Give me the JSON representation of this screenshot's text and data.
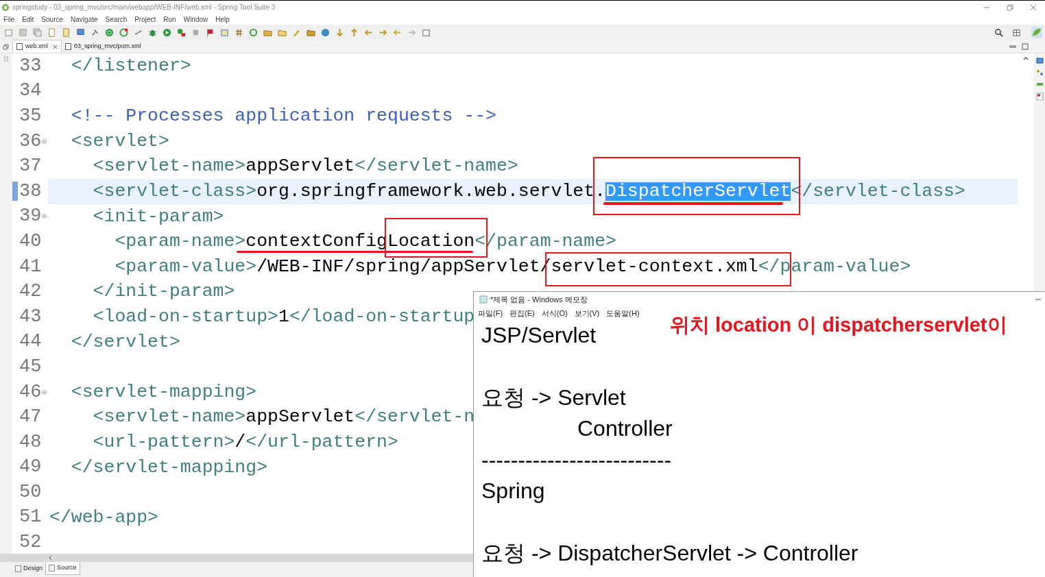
{
  "window": {
    "title": "springstudy - 03_spring_mvc/src/main/webapp/WEB-INF/web.xml - Spring Tool Suite 3"
  },
  "menu": [
    "File",
    "Edit",
    "Source",
    "Navigate",
    "Search",
    "Project",
    "Run",
    "Window",
    "Help"
  ],
  "editor_tabs": [
    {
      "label": "web.xml",
      "selected": true,
      "closable": true
    },
    {
      "label": "03_spring_mvc/pom.xml",
      "selected": false,
      "closable": false
    }
  ],
  "code_lines": [
    {
      "number": "33",
      "foldable": false,
      "current": false,
      "segments": [
        {
          "kind": "tag",
          "text": "  </listener>"
        }
      ]
    },
    {
      "number": "34",
      "foldable": false,
      "current": false
    },
    {
      "number": "35",
      "foldable": false,
      "current": false,
      "segments": [
        {
          "kind": "comment",
          "text": "  <!-- Processes application requests -->"
        }
      ]
    },
    {
      "number": "36",
      "foldable": true,
      "current": false,
      "segments": [
        {
          "kind": "tag",
          "text": "  <servlet>"
        }
      ]
    },
    {
      "number": "37",
      "foldable": false,
      "current": false,
      "segments": [
        {
          "kind": "tag",
          "text": "    <servlet-name>"
        },
        {
          "kind": "text",
          "text": "appServlet"
        },
        {
          "kind": "tag",
          "text": "</servlet-name>"
        }
      ]
    },
    {
      "number": "38",
      "foldable": false,
      "current": true,
      "segments": [
        {
          "kind": "tag",
          "text": "    <servlet-class>"
        },
        {
          "kind": "text",
          "text": "org.springframework.web.servlet."
        },
        {
          "kind": "selection",
          "text": "DispatcherServlet"
        },
        {
          "kind": "tag",
          "text": "</servlet-class>"
        }
      ]
    },
    {
      "number": "39",
      "foldable": true,
      "current": false,
      "segments": [
        {
          "kind": "tag",
          "text": "    <init-param>"
        }
      ]
    },
    {
      "number": "40",
      "foldable": false,
      "current": false,
      "segments": [
        {
          "kind": "tag",
          "text": "      <param-name>"
        },
        {
          "kind": "text",
          "text": "contextConfigLocation"
        },
        {
          "kind": "tag",
          "text": "</param-name>"
        }
      ]
    },
    {
      "number": "41",
      "foldable": false,
      "current": false,
      "segments": [
        {
          "kind": "tag",
          "text": "      <param-value>"
        },
        {
          "kind": "text",
          "text": "/WEB-INF/spring/appServlet/servlet-context.xml"
        },
        {
          "kind": "tag",
          "text": "</param-value>"
        }
      ]
    },
    {
      "number": "42",
      "foldable": false,
      "current": false,
      "segments": [
        {
          "kind": "tag",
          "text": "    </init-param>"
        }
      ]
    },
    {
      "number": "43",
      "foldable": false,
      "current": false,
      "segments": [
        {
          "kind": "tag",
          "text": "    <load-on-startup>"
        },
        {
          "kind": "text",
          "text": "1"
        },
        {
          "kind": "tag",
          "text": "</load-on-startup"
        }
      ]
    },
    {
      "number": "44",
      "foldable": false,
      "current": false,
      "segments": [
        {
          "kind": "tag",
          "text": "  </servlet>"
        }
      ]
    },
    {
      "number": "45",
      "foldable": false,
      "current": false
    },
    {
      "number": "46",
      "foldable": true,
      "current": false,
      "segments": [
        {
          "kind": "tag",
          "text": "  <servlet-mapping>"
        }
      ]
    },
    {
      "number": "47",
      "foldable": false,
      "current": false,
      "segments": [
        {
          "kind": "tag",
          "text": "    <servlet-name>"
        },
        {
          "kind": "text",
          "text": "appServlet"
        },
        {
          "kind": "tag",
          "text": "</servlet-n"
        }
      ]
    },
    {
      "number": "48",
      "foldable": false,
      "current": false,
      "segments": [
        {
          "kind": "tag",
          "text": "    <url-pattern>"
        },
        {
          "kind": "text",
          "text": "/"
        },
        {
          "kind": "tag",
          "text": "</url-pattern>"
        }
      ]
    },
    {
      "number": "49",
      "foldable": false,
      "current": false,
      "segments": [
        {
          "kind": "tag",
          "text": "  </servlet-mapping>"
        }
      ]
    },
    {
      "number": "50",
      "foldable": false,
      "current": false
    },
    {
      "number": "51",
      "foldable": false,
      "current": false,
      "segments": [
        {
          "kind": "tag",
          "text": "</web-app>"
        }
      ]
    },
    {
      "number": "52",
      "foldable": false,
      "current": false
    }
  ],
  "bottom_tabs": [
    {
      "label": "Design",
      "selected": false
    },
    {
      "label": "Source",
      "selected": true
    }
  ],
  "notepad": {
    "title": "*제목 없음 - Windows 메모장",
    "menu": [
      "파일(F)",
      "편집(E)",
      "서식(O)",
      "보기(V)",
      "도움말(H)"
    ],
    "lines": [
      {
        "kind": "text",
        "text": "JSP/Servlet"
      },
      {
        "kind": "blank"
      },
      {
        "kind": "text",
        "text": "요청 -> Servlet"
      },
      {
        "kind": "indented",
        "text": "Controller"
      },
      {
        "kind": "text",
        "text": "--------------------------"
      },
      {
        "kind": "text",
        "text": "Spring"
      },
      {
        "kind": "blank"
      },
      {
        "kind": "text",
        "text": "요청 -> DispatcherServlet -> Controller"
      }
    ]
  },
  "annotation": {
    "text": "위치 location 이 dispatcherservlet이"
  }
}
